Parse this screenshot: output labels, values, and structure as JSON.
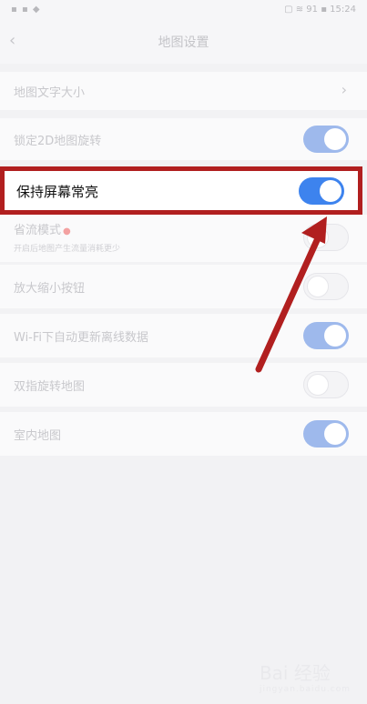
{
  "status": {
    "left": "▪ ▪ ◆",
    "right": "▢ ≋ 91 ▪ 15:24"
  },
  "nav": {
    "back_icon": "‹",
    "title": "地图设置"
  },
  "rows": [
    {
      "label": "地图文字大小",
      "control": "chevron"
    },
    {
      "label": "锁定2D地图旋转",
      "control": "toggle",
      "on": true
    },
    {
      "label": "保持屏幕常亮",
      "control": "toggle",
      "on": true
    },
    {
      "label": "省流模式",
      "sub": "开启后地图产生流量消耗更少",
      "control": "toggle",
      "on": false
    },
    {
      "label": "放大缩小按钮",
      "control": "toggle",
      "on": false
    },
    {
      "label": "Wi-Fi下自动更新离线数据",
      "control": "toggle",
      "on": true
    },
    {
      "label": "双指旋转地图",
      "control": "toggle",
      "on": false
    },
    {
      "label": "室内地图",
      "control": "toggle",
      "on": true
    }
  ],
  "chevron_icon": "›",
  "dot": "●",
  "watermark": {
    "brand": "Bai 经验",
    "sub": "jingyan.baidu.com"
  },
  "colors": {
    "highlight": "#b11f1f",
    "toggle_on": "#3d83ee",
    "arrow": "#b11f1f"
  }
}
